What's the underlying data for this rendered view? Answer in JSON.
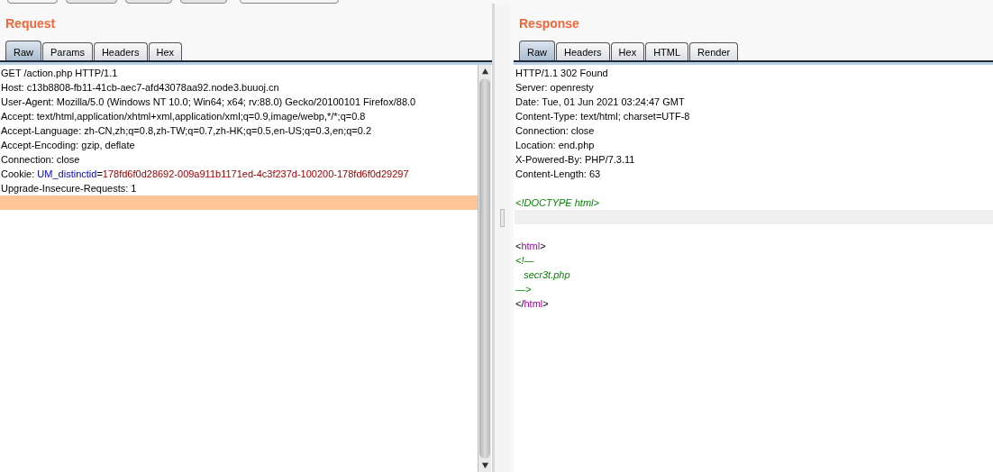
{
  "request": {
    "title": "Request",
    "tabs": [
      {
        "label": "Raw",
        "selected": true
      },
      {
        "label": "Params",
        "selected": false
      },
      {
        "label": "Headers",
        "selected": false
      },
      {
        "label": "Hex",
        "selected": false
      }
    ],
    "lines": [
      {
        "kind": "text",
        "segments": [
          {
            "kind": "plain",
            "text": "GET /action.php HTTP/1.1"
          }
        ]
      },
      {
        "kind": "text",
        "segments": [
          {
            "kind": "plain",
            "text": "Host: c13b8808-fb11-41cb-aec7-afd43078aa92.node3.buuoj.cn"
          }
        ]
      },
      {
        "kind": "text",
        "segments": [
          {
            "kind": "plain",
            "text": "User-Agent: Mozilla/5.0 (Windows NT 10.0; Win64; x64; rv:88.0) Gecko/20100101 Firefox/88.0"
          }
        ]
      },
      {
        "kind": "text",
        "segments": [
          {
            "kind": "plain",
            "text": "Accept: text/html,application/xhtml+xml,application/xml;q=0.9,image/webp,*/*;q=0.8"
          }
        ]
      },
      {
        "kind": "text",
        "segments": [
          {
            "kind": "plain",
            "text": "Accept-Language: zh-CN,zh;q=0.8,zh-TW;q=0.7,zh-HK;q=0.5,en-US;q=0.3,en;q=0.2"
          }
        ]
      },
      {
        "kind": "text",
        "segments": [
          {
            "kind": "plain",
            "text": "Accept-Encoding: gzip, deflate"
          }
        ]
      },
      {
        "kind": "text",
        "segments": [
          {
            "kind": "plain",
            "text": "Connection: close"
          }
        ]
      },
      {
        "kind": "text",
        "segments": [
          {
            "kind": "plain",
            "text": "Cookie: "
          },
          {
            "kind": "name",
            "text": "UM_distinctid"
          },
          {
            "kind": "plain",
            "text": "="
          },
          {
            "kind": "value",
            "text": "178fd6f0d28692-009a911b1171ed-4c3f237d-100200-178fd6f0d29297"
          }
        ]
      },
      {
        "kind": "text",
        "segments": [
          {
            "kind": "plain",
            "text": "Upgrade-Insecure-Requests: 1"
          }
        ]
      },
      {
        "kind": "current"
      }
    ]
  },
  "response": {
    "title": "Response",
    "tabs": [
      {
        "label": "Raw",
        "selected": true
      },
      {
        "label": "Headers",
        "selected": false
      },
      {
        "label": "Hex",
        "selected": false
      },
      {
        "label": "HTML",
        "selected": false
      },
      {
        "label": "Render",
        "selected": false
      }
    ],
    "lines": [
      {
        "kind": "text",
        "segments": [
          {
            "kind": "plain",
            "text": "HTTP/1.1 302 Found"
          }
        ]
      },
      {
        "kind": "text",
        "segments": [
          {
            "kind": "plain",
            "text": "Server: openresty"
          }
        ]
      },
      {
        "kind": "text",
        "segments": [
          {
            "kind": "plain",
            "text": "Date: Tue, 01 Jun 2021 03:24:47 GMT"
          }
        ]
      },
      {
        "kind": "text",
        "segments": [
          {
            "kind": "plain",
            "text": "Content-Type: text/html; charset=UTF-8"
          }
        ]
      },
      {
        "kind": "text",
        "segments": [
          {
            "kind": "plain",
            "text": "Connection: close"
          }
        ]
      },
      {
        "kind": "text",
        "segments": [
          {
            "kind": "plain",
            "text": "Location: end.php"
          }
        ]
      },
      {
        "kind": "text",
        "segments": [
          {
            "kind": "plain",
            "text": "X-Powered-By: PHP/7.3.11"
          }
        ]
      },
      {
        "kind": "text",
        "segments": [
          {
            "kind": "plain",
            "text": "Content-Length: 63"
          }
        ]
      },
      {
        "kind": "blank"
      },
      {
        "kind": "text",
        "segments": [
          {
            "kind": "comment",
            "text": "<!DOCTYPE html>"
          }
        ]
      },
      {
        "kind": "current"
      },
      {
        "kind": "blank"
      },
      {
        "kind": "text",
        "segments": [
          {
            "kind": "plain",
            "text": "<"
          },
          {
            "kind": "tag",
            "text": "html"
          },
          {
            "kind": "plain",
            "text": ">"
          }
        ]
      },
      {
        "kind": "text",
        "segments": [
          {
            "kind": "comment",
            "text": "<!—"
          }
        ]
      },
      {
        "kind": "text",
        "segments": [
          {
            "kind": "comment",
            "text": "   secr3t.php"
          }
        ]
      },
      {
        "kind": "text",
        "segments": [
          {
            "kind": "comment",
            "text": "—>"
          }
        ]
      },
      {
        "kind": "text",
        "segments": [
          {
            "kind": "plain",
            "text": "</"
          },
          {
            "kind": "tag",
            "text": "html"
          },
          {
            "kind": "plain",
            "text": ">"
          }
        ]
      }
    ]
  }
}
